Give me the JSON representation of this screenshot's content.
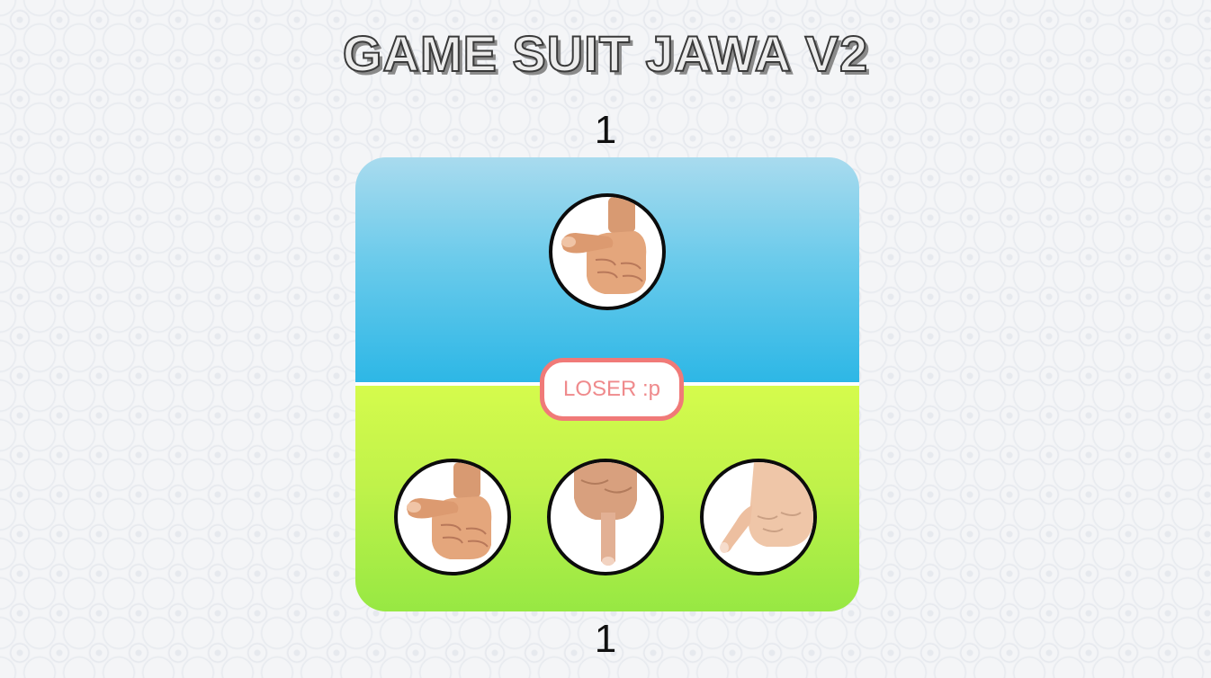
{
  "game": {
    "title": "GAME SUIT JAWA V2",
    "computer_score": "1",
    "player_score": "1",
    "result_text": "LOSER :p"
  },
  "computer_choice": {
    "icon": "thumb-icon"
  },
  "player_choices": [
    {
      "icon": "thumb-icon"
    },
    {
      "icon": "index-finger-icon"
    },
    {
      "icon": "pinky-finger-icon"
    }
  ],
  "colors": {
    "top_panel_start": "#a9dbee",
    "top_panel_end": "#2db7e6",
    "bottom_panel_start": "#d5fb4c",
    "bottom_panel_end": "#97e843",
    "result_border": "#f07a78",
    "result_text": "#ef8a8c"
  }
}
